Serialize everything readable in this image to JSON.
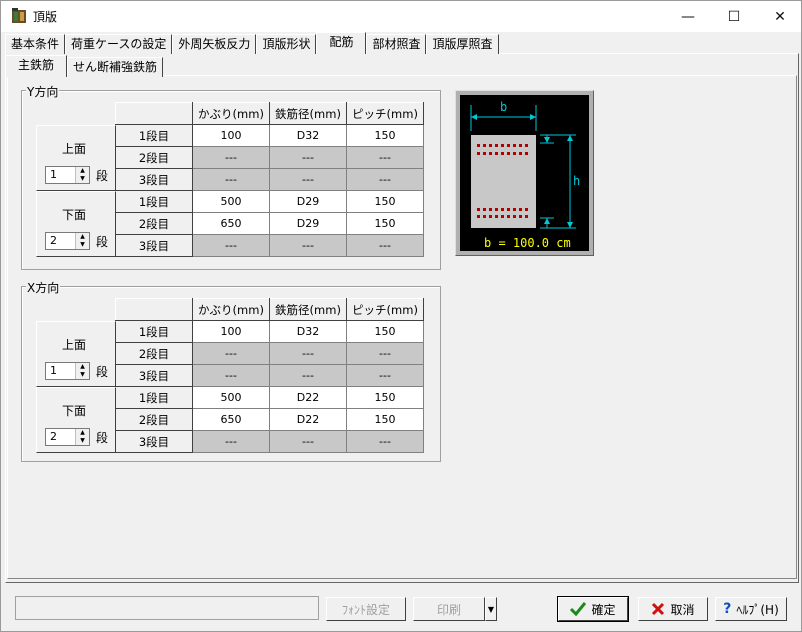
{
  "window": {
    "title": "頂版",
    "min_glyph": "—",
    "max_glyph": "☐",
    "close_glyph": "✕"
  },
  "tabs": [
    "基本条件",
    "荷重ケースの設定",
    "外周矢板反力",
    "頂版形状",
    "配筋",
    "部材照査",
    "頂版厚照査"
  ],
  "active_tab": "配筋",
  "subtabs": [
    "主鉄筋",
    "せん断補強鉄筋"
  ],
  "active_subtab": "主鉄筋",
  "columns": [
    "かぶり(mm)",
    "鉄筋径(mm)",
    "ピッチ(mm)"
  ],
  "row_labels": [
    "1段目",
    "2段目",
    "3段目"
  ],
  "dan_label": "段",
  "y_dir": {
    "title": "Y方向",
    "top": {
      "label": "上面",
      "count": "1",
      "rows": [
        [
          "100",
          "D32",
          "150"
        ],
        [
          "---",
          "---",
          "---"
        ],
        [
          "---",
          "---",
          "---"
        ]
      ]
    },
    "bottom": {
      "label": "下面",
      "count": "2",
      "rows": [
        [
          "500",
          "D29",
          "150"
        ],
        [
          "650",
          "D29",
          "150"
        ],
        [
          "---",
          "---",
          "---"
        ]
      ]
    }
  },
  "x_dir": {
    "title": "X方向",
    "top": {
      "label": "上面",
      "count": "1",
      "rows": [
        [
          "100",
          "D32",
          "150"
        ],
        [
          "---",
          "---",
          "---"
        ],
        [
          "---",
          "---",
          "---"
        ]
      ]
    },
    "bottom": {
      "label": "下面",
      "count": "2",
      "rows": [
        [
          "500",
          "D22",
          "150"
        ],
        [
          "650",
          "D22",
          "150"
        ],
        [
          "---",
          "---",
          "---"
        ]
      ]
    }
  },
  "diagram": {
    "b_label": "b",
    "h_label": "h",
    "caption": "b = 100.0 cm"
  },
  "buttons": {
    "font": "ﾌｫﾝﾄ設定",
    "print": "印刷",
    "ok": "確定",
    "cancel": "取消",
    "help": "ﾍﾙﾌﾟ(H)"
  },
  "status_text": ""
}
